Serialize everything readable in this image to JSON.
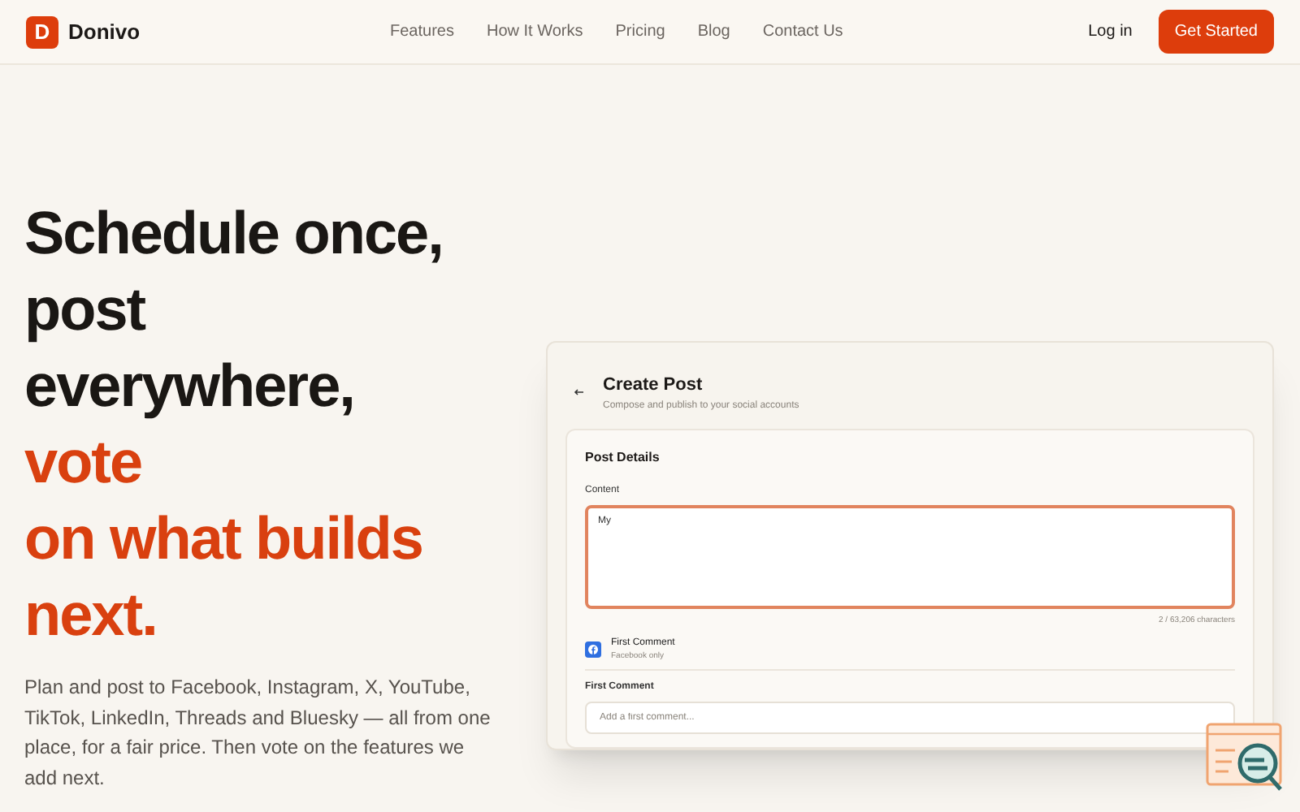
{
  "brand": {
    "logo_letter": "D",
    "name": "Donivo"
  },
  "nav": [
    "Features",
    "How It Works",
    "Pricing",
    "Blog",
    "Contact Us"
  ],
  "login": "Log in",
  "cta": "Get Started",
  "headline": [
    {
      "text": "Schedule once,",
      "accent": false
    },
    {
      "text": "post",
      "accent": false
    },
    {
      "text": "everywhere,",
      "accent": false
    },
    {
      "text": "vote",
      "accent": true
    },
    {
      "text": "on what builds",
      "accent": true
    },
    {
      "text": "next.",
      "accent": true
    }
  ],
  "description": "Plan and post to Facebook, Instagram, X, YouTube, TikTok, LinkedIn, Threads and Bluesky — all from one place, for a fair price. Then vote on the features we add next.",
  "preview": {
    "title": "Create Post",
    "subtitle": "Compose and publish to your social accounts",
    "section": "Post Details",
    "content_label": "Content",
    "content_value": "My",
    "counter": "2 / 63,206 characters",
    "first_comment_title": "First Comment",
    "first_comment_note": "Facebook only",
    "comment_label": "First Comment",
    "comment_placeholder": "Add a first comment..."
  }
}
